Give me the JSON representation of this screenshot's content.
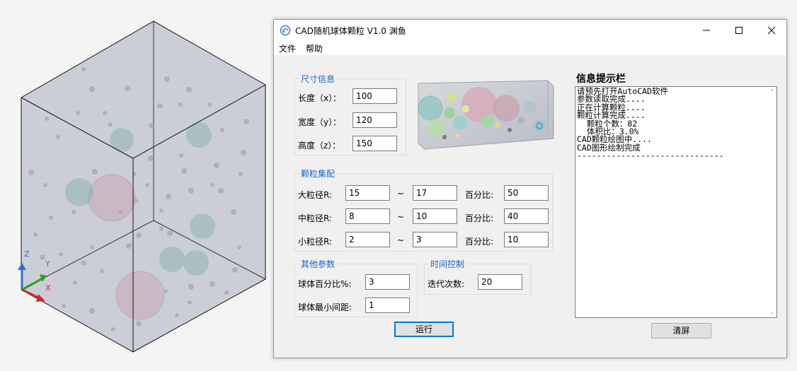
{
  "window": {
    "title": "CAD随机球体颗粒 V1.0 渊鱼",
    "menu": [
      "文件",
      "帮助"
    ]
  },
  "size_group": {
    "legend": "尺寸信息",
    "length_label": "长度（x）：",
    "length_value": "100",
    "width_label": "宽度（y）：",
    "width_value": "120",
    "height_label": "高度（z）：",
    "height_value": "150"
  },
  "grading_group": {
    "legend": "颗粒集配",
    "tilde": "~",
    "percent_label": "百分比:",
    "rows": [
      {
        "label": "大粒径R:",
        "min": "15",
        "max": "17",
        "percent": "50"
      },
      {
        "label": "中粒径R:",
        "min": "8",
        "max": "10",
        "percent": "40"
      },
      {
        "label": "小粒径R:",
        "min": "2",
        "max": "3",
        "percent": "10"
      }
    ]
  },
  "other_group": {
    "legend": "其他参数",
    "sphere_percent_label": "球体百分比%:",
    "sphere_percent_value": "3",
    "min_spacing_label": "球体最小间距:",
    "min_spacing_value": "1"
  },
  "time_group": {
    "legend": "时间控制",
    "iterations_label": "迭代次数:",
    "iterations_value": "20"
  },
  "buttons": {
    "run": "运行",
    "clear": "清屏"
  },
  "info": {
    "title": "信息提示栏",
    "lines": [
      "请预先打开AutoCAD软件",
      "参数读取完成....",
      "正在计算颗粒....",
      "颗粒计算完成....",
      "  颗粒个数：82",
      "  体积比：3.0%",
      "CAD颗粒绘图中....",
      "CAD图形绘制完成",
      "------------------------------"
    ]
  },
  "cad_axes": {
    "z": "Z",
    "y": "Y",
    "x": "X"
  },
  "colors": {
    "accent_blue": "#1e64c8",
    "cube_fill": "#c3c6d0",
    "sphere_pink": "#c9a8b4",
    "sphere_teal": "#8fb2b1"
  }
}
